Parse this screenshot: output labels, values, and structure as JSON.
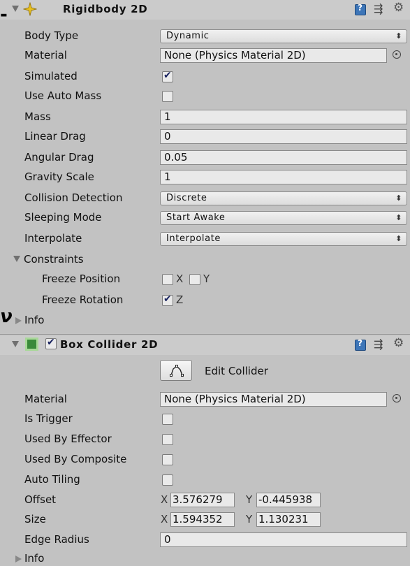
{
  "rigidbody": {
    "title": "Rigidbody 2D",
    "fields": {
      "body_type": {
        "label": "Body Type",
        "value": "Dynamic"
      },
      "material": {
        "label": "Material",
        "value": "None (Physics Material 2D)"
      },
      "simulated": {
        "label": "Simulated",
        "checked": true
      },
      "use_auto_mass": {
        "label": "Use Auto Mass",
        "checked": false
      },
      "mass": {
        "label": "Mass",
        "value": "1"
      },
      "linear_drag": {
        "label": "Linear Drag",
        "value": "0"
      },
      "angular_drag": {
        "label": "Angular Drag",
        "value": "0.05"
      },
      "gravity_scale": {
        "label": "Gravity Scale",
        "value": "1"
      },
      "collision_detection": {
        "label": "Collision Detection",
        "value": "Discrete"
      },
      "sleeping_mode": {
        "label": "Sleeping Mode",
        "value": "Start Awake"
      },
      "interpolate": {
        "label": "Interpolate",
        "value": "Interpolate"
      }
    },
    "constraints": {
      "label": "Constraints",
      "freeze_position": {
        "label": "Freeze Position",
        "x_label": "X",
        "y_label": "Y",
        "x": false,
        "y": false
      },
      "freeze_rotation": {
        "label": "Freeze Rotation",
        "z_label": "Z",
        "z": true
      }
    },
    "info_label": "Info"
  },
  "box_collider": {
    "title": "Box Collider 2D",
    "enabled": true,
    "edit_collider_label": "Edit Collider",
    "fields": {
      "material": {
        "label": "Material",
        "value": "None (Physics Material 2D)"
      },
      "is_trigger": {
        "label": "Is Trigger",
        "checked": false
      },
      "used_by_effector": {
        "label": "Used By Effector",
        "checked": false
      },
      "used_by_composite": {
        "label": "Used By Composite",
        "checked": false
      },
      "auto_tiling": {
        "label": "Auto Tiling",
        "checked": false
      },
      "offset": {
        "label": "Offset",
        "x_label": "X",
        "y_label": "Y",
        "x": "3.576279",
        "y": "-0.445938"
      },
      "size": {
        "label": "Size",
        "x_label": "X",
        "y_label": "Y",
        "x": "1.594352",
        "y": "1.130231"
      },
      "edge_radius": {
        "label": "Edge Radius",
        "value": "0"
      }
    },
    "info_label": "Info"
  },
  "icons": [
    "foldout-arrow-icon",
    "rigidbody-icon",
    "help-book-icon",
    "presets-icon",
    "gear-icon",
    "object-picker-icon",
    "dropdown-arrow-icon",
    "checkbox-icon",
    "box-collider-icon",
    "edit-collider-icon"
  ],
  "colors": {
    "panel_bg": "#c2c2c2",
    "field_bg": "#e9e9e9",
    "help_icon": "#3e76b8",
    "rigidbody_icon": "#e8c020",
    "collider_icon": "#3a8a3a"
  }
}
